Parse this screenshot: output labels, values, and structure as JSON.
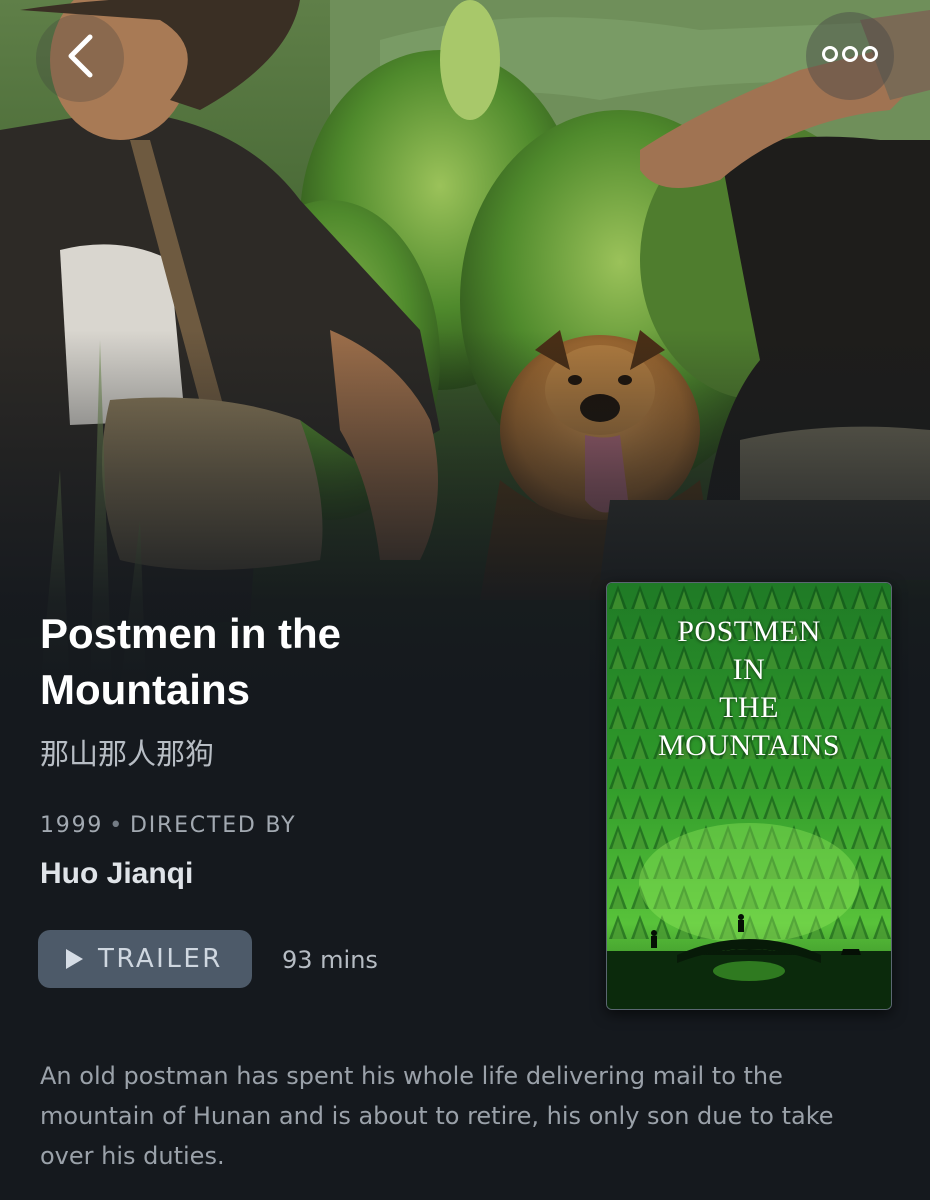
{
  "nav": {
    "back_icon": "chevron-left-icon",
    "more_icon": "more-horizontal-icon"
  },
  "film": {
    "title": "Postmen in the Mountains",
    "original_title": "那山那人那狗",
    "year": "1999",
    "credit_label": "DIRECTED BY",
    "director": "Huo Jianqi",
    "runtime": "93 mins",
    "synopsis": "An old postman has spent his whole life delivering mail to the mountain of Hunan and is about to retire, his only son due to take over his duties."
  },
  "actions": {
    "trailer_label": "TRAILER",
    "trailer_icon": "play-icon"
  },
  "poster": {
    "title_lines": [
      "POSTMEN",
      "IN",
      "THE",
      "MOUNTAINS"
    ]
  },
  "colors": {
    "background": "#15191e",
    "trailer_button": "#4d5a69",
    "poster_green": "#2f9a2a"
  }
}
